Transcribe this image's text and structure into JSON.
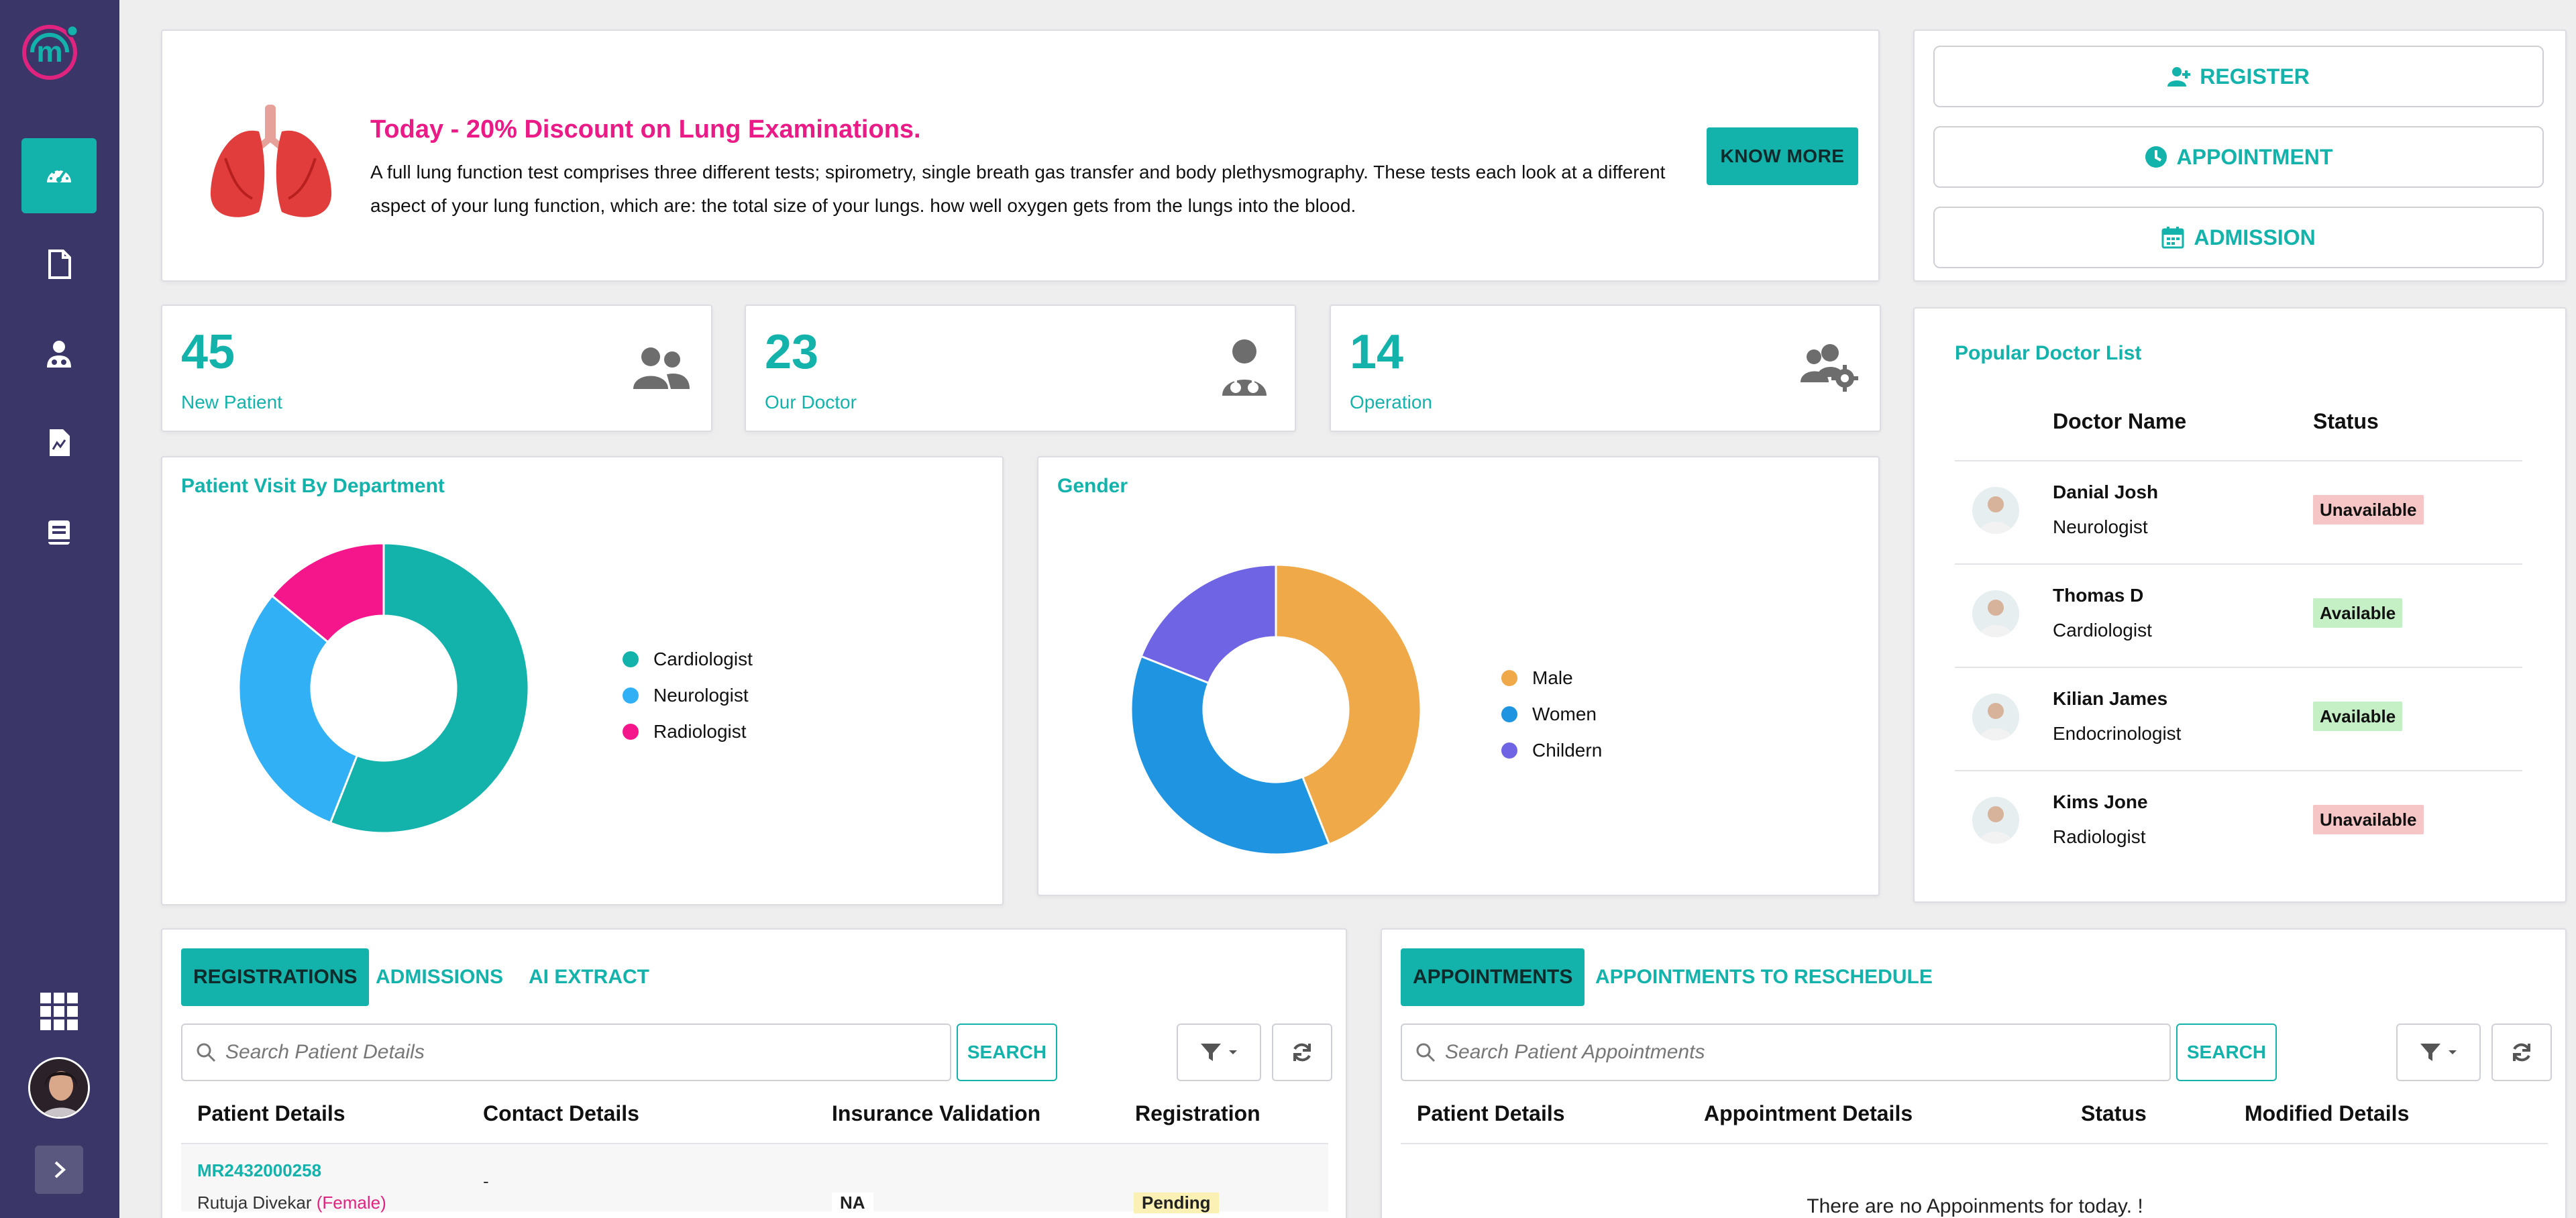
{
  "sidebar": {
    "icons": [
      "dashboard-gauge-icon",
      "document-icon",
      "doctor-icon",
      "report-icon",
      "book-icon"
    ],
    "apps_icon": "grid-apps-icon",
    "expand_icon": "chevron-right-icon"
  },
  "banner": {
    "title": "Today - 20% Discount on Lung Examinations.",
    "text": "A full lung function test comprises three different tests; spirometry, single breath gas transfer and body plethysmography. These tests each look at a different aspect of your lung function, which are: the total size of your lungs. how well oxygen gets from the lungs into the blood.",
    "button": "KNOW MORE"
  },
  "actions": {
    "register": "REGISTER",
    "appointment": "APPOINTMENT",
    "admission": "ADMISSION"
  },
  "stats": [
    {
      "value": "45",
      "label": "New Patient",
      "icon": "users-icon"
    },
    {
      "value": "23",
      "label": "Our Doctor",
      "icon": "doctor-stethoscope-icon"
    },
    {
      "value": "14",
      "label": "Operation",
      "icon": "users-gear-icon"
    }
  ],
  "chart_data": [
    {
      "type": "pie",
      "title": "Patient Visit By Department",
      "categories": [
        "Cardiologist",
        "Neurologist",
        "Radiologist"
      ],
      "values": [
        56,
        30,
        14
      ],
      "colors": [
        "#13b3ac",
        "#31b0f5",
        "#f5168c"
      ]
    },
    {
      "type": "pie",
      "title": "Gender",
      "categories": [
        "Male",
        "Women",
        "Childern"
      ],
      "values": [
        44,
        37,
        19
      ],
      "colors": [
        "#efa948",
        "#1f95e2",
        "#6f64e3"
      ]
    }
  ],
  "doctors": {
    "title": "Popular Doctor List",
    "col_name": "Doctor Name",
    "col_status": "Status",
    "rows": [
      {
        "name": "Danial Josh",
        "specialty": "Neurologist",
        "status": "Unavailable"
      },
      {
        "name": "Thomas D",
        "specialty": "Cardiologist",
        "status": "Available"
      },
      {
        "name": "Kilian James",
        "specialty": "Endocrinologist",
        "status": "Available"
      },
      {
        "name": "Kims Jone",
        "specialty": "Radiologist",
        "status": "Unavailable"
      }
    ]
  },
  "registrations": {
    "tabs": [
      "REGISTRATIONS",
      "ADMISSIONS",
      "AI EXTRACT"
    ],
    "search_placeholder": "Search Patient Details",
    "search_btn": "SEARCH",
    "columns": [
      "Patient Details",
      "Contact Details",
      "Insurance Validation",
      "Registration"
    ],
    "row": {
      "mrn": "MR2432000258",
      "name": "Rutuja Divekar",
      "gender": "(Female)",
      "contact": "-",
      "insurance": "NA",
      "registration": "Pending"
    }
  },
  "appointments": {
    "tabs": [
      "APPOINTMENTS",
      "APPOINTMENTS TO RESCHEDULE"
    ],
    "search_placeholder": "Search Patient Appointments",
    "search_btn": "SEARCH",
    "columns": [
      "Patient Details",
      "Appointment Details",
      "Status",
      "Modified Details"
    ],
    "empty": "There are no Appoinments for today. !"
  }
}
